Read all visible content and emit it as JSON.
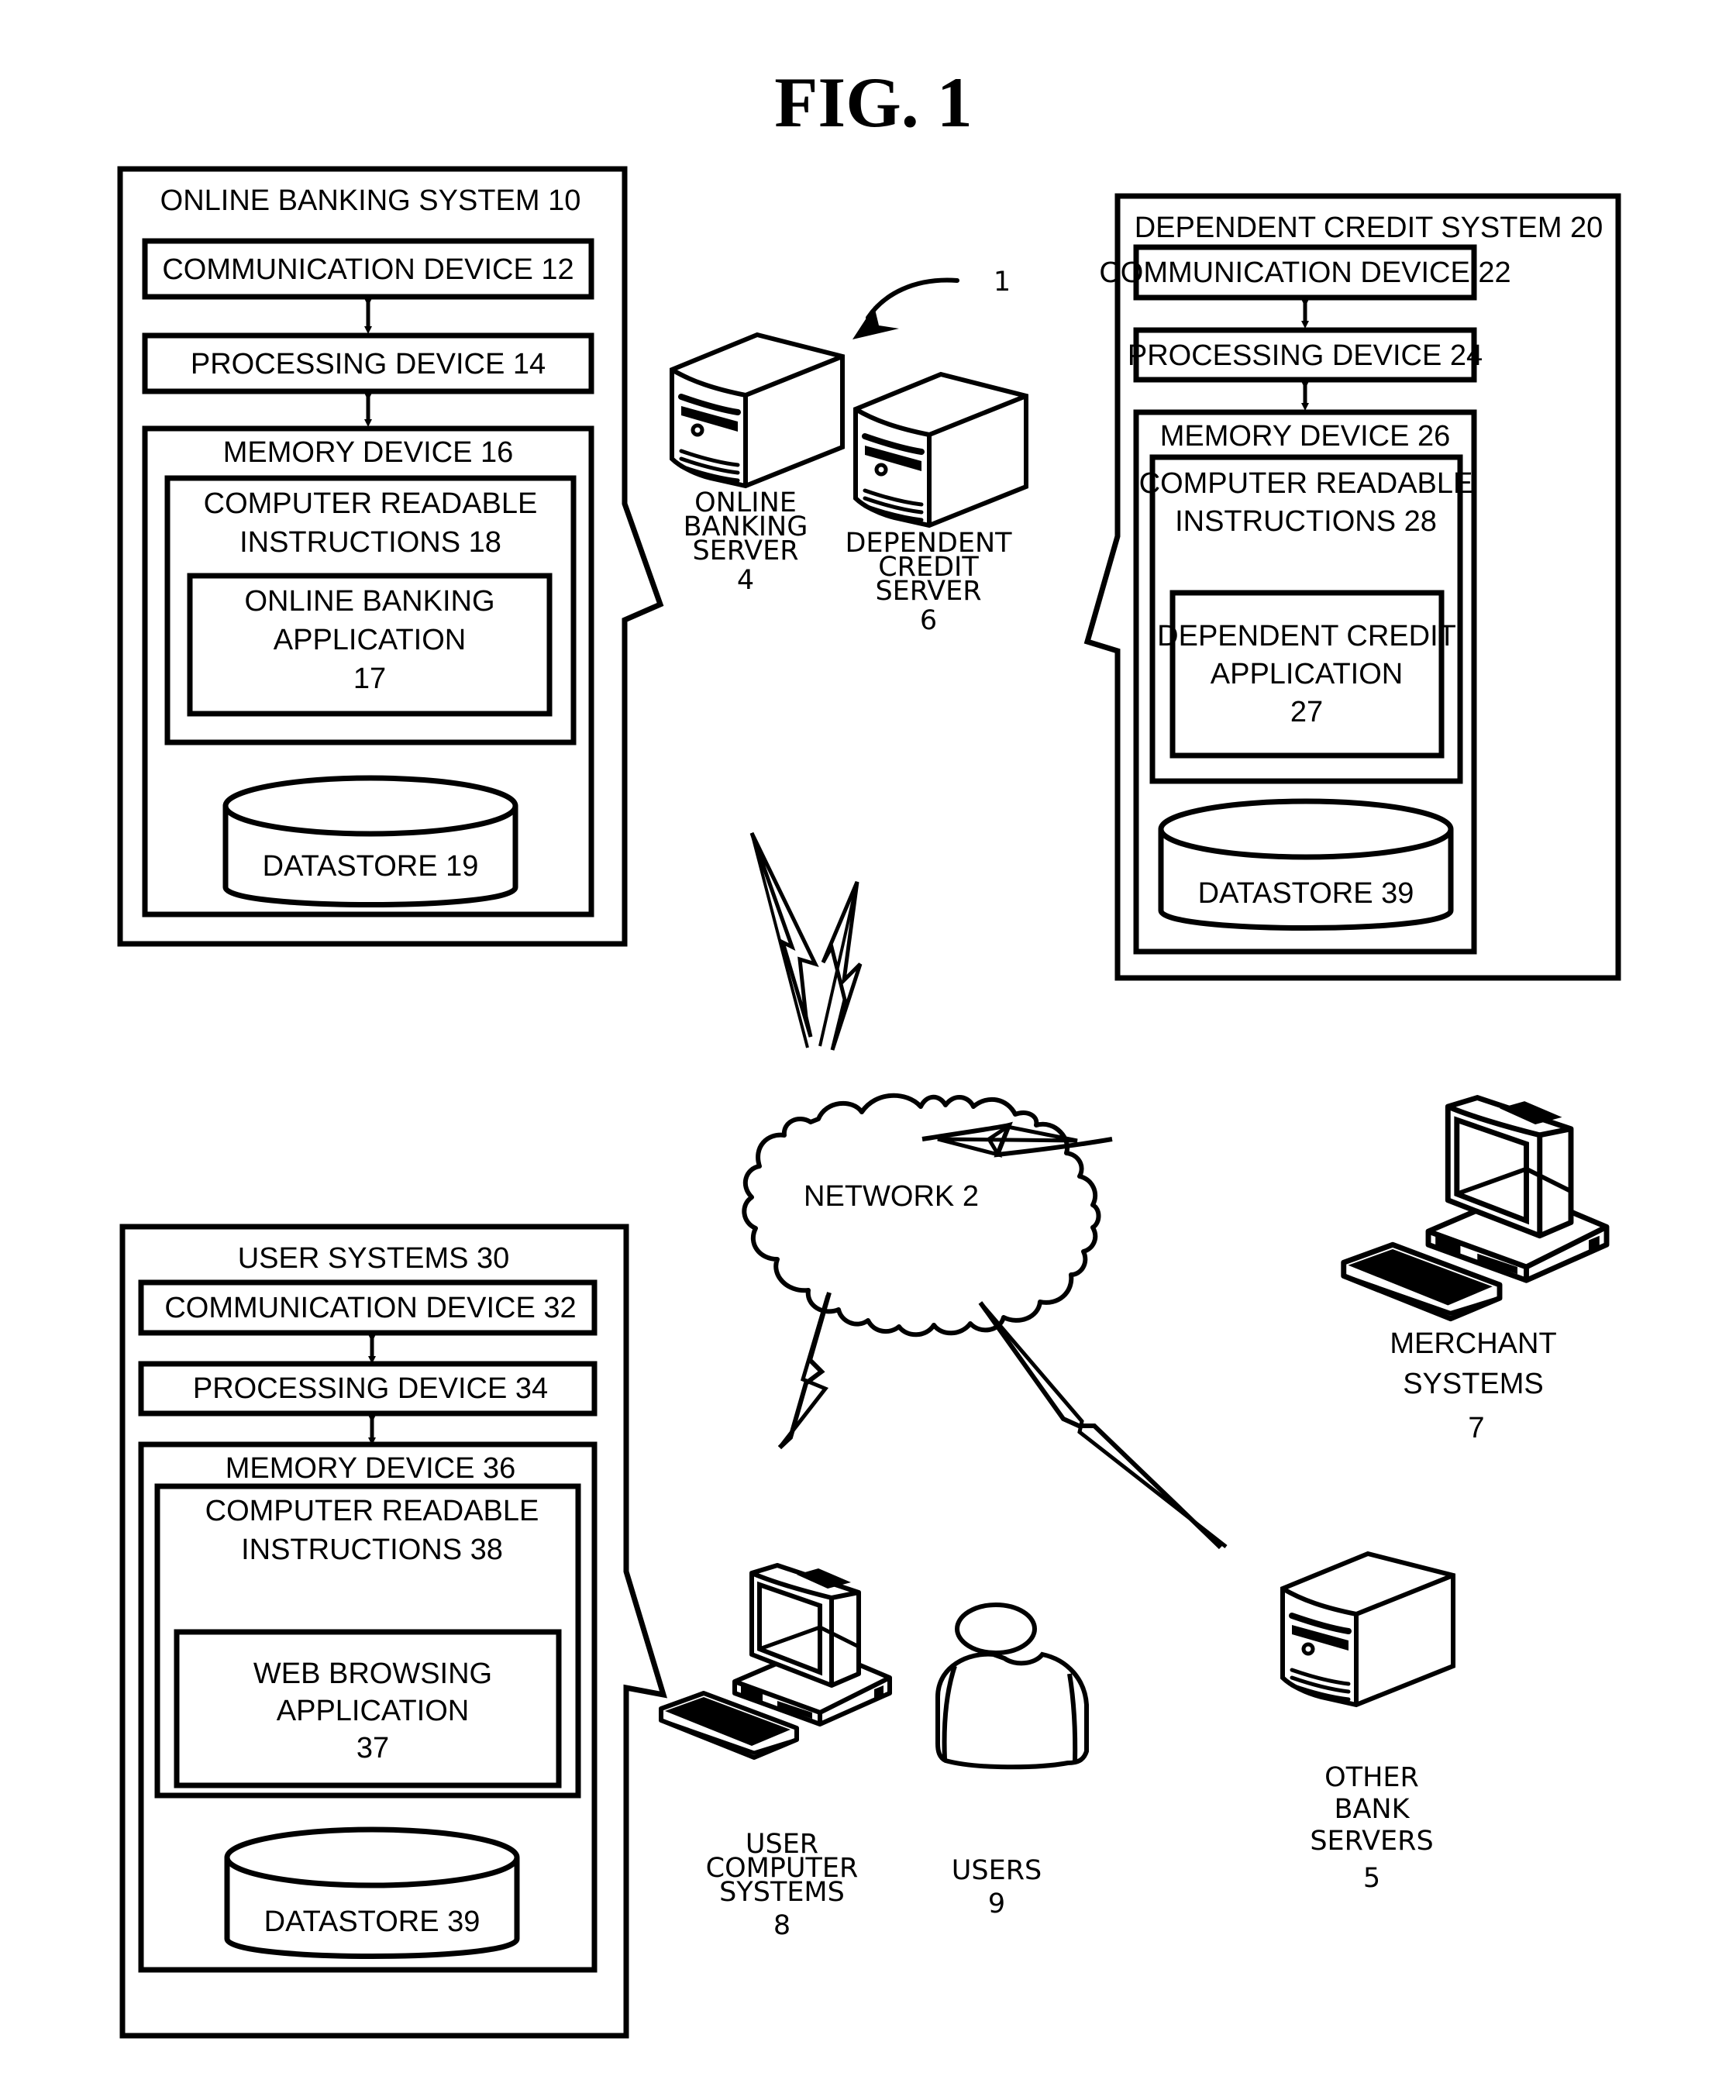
{
  "figure": {
    "title": "FIG. 1",
    "reference_label": "1"
  },
  "online_banking_system": {
    "title": "ONLINE BANKING SYSTEM 10",
    "communication_device": "COMMUNICATION DEVICE 12",
    "processing_device": "PROCESSING DEVICE 14",
    "memory_device": "MEMORY DEVICE 16",
    "instructions": [
      "COMPUTER READABLE",
      "INSTRUCTIONS 18"
    ],
    "application": [
      "ONLINE BANKING",
      "APPLICATION",
      "17"
    ],
    "datastore": "DATASTORE 19"
  },
  "dependent_credit_system": {
    "title": "DEPENDENT CREDIT SYSTEM 20",
    "communication_device": "COMMUNICATION DEVICE 22",
    "processing_device": "PROCESSING DEVICE 24",
    "memory_device": "MEMORY DEVICE 26",
    "instructions": [
      "COMPUTER READABLE",
      "INSTRUCTIONS 28"
    ],
    "application": [
      "DEPENDENT CREDIT",
      "APPLICATION",
      "27"
    ],
    "datastore": "DATASTORE 39"
  },
  "user_systems": {
    "title": "USER SYSTEMS 30",
    "communication_device": "COMMUNICATION DEVICE 32",
    "processing_device": "PROCESSING DEVICE 34",
    "memory_device": "MEMORY DEVICE 36",
    "instructions": [
      "COMPUTER READABLE",
      "INSTRUCTIONS 38"
    ],
    "application": [
      "WEB BROWSING",
      "APPLICATION",
      "37"
    ],
    "datastore": "DATASTORE 39"
  },
  "nodes": {
    "online_banking_server": [
      "ONLINE",
      "BANKING",
      "SERVER",
      "4"
    ],
    "dependent_credit_server": [
      "DEPENDENT",
      "CREDIT",
      "SERVER",
      "6"
    ],
    "network": "NETWORK 2",
    "merchant_systems": [
      "MERCHANT",
      "SYSTEMS",
      "7"
    ],
    "user_computer_systems": [
      "USER",
      "COMPUTER",
      "SYSTEMS",
      "8"
    ],
    "users": [
      "USERS",
      "9"
    ],
    "other_bank_servers": [
      "OTHER",
      "BANK",
      "SERVERS",
      "5"
    ]
  }
}
